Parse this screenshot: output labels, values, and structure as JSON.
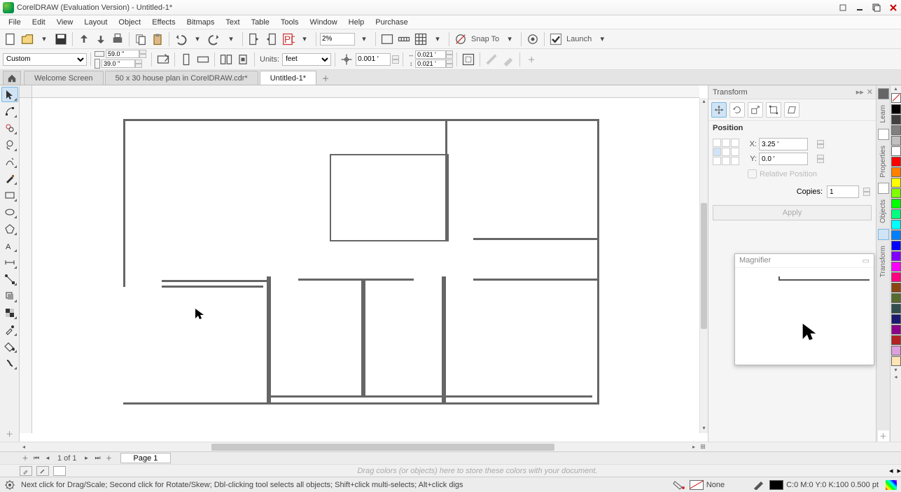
{
  "title": "CorelDRAW (Evaluation Version) - Untitled-1*",
  "menu": [
    "File",
    "Edit",
    "View",
    "Layout",
    "Object",
    "Effects",
    "Bitmaps",
    "Text",
    "Table",
    "Tools",
    "Window",
    "Help",
    "Purchase"
  ],
  "toolbar1": {
    "zoom": "2%",
    "snap_label": "Snap To",
    "launch_label": "Launch"
  },
  "propbar": {
    "page_preset": "Custom",
    "width": "59.0 \"",
    "height": "39.0 \"",
    "units_label": "Units:",
    "units_value": "feet",
    "nudge": "0.001 '",
    "dup_x": "0.021 '",
    "dup_y": "0.021 '"
  },
  "tabs": {
    "home": "home",
    "t1": "Welcome Screen",
    "t2": "50 x 30 house plan in CorelDRAW.cdr*",
    "t3": "Untitled-1*"
  },
  "docker": {
    "title": "Transform",
    "section": "Position",
    "x_label": "X:",
    "x_val": "3.25 '",
    "y_label": "Y:",
    "y_val": "0.0 '",
    "relative": "Relative Position",
    "copies_label": "Copies:",
    "copies_val": "1",
    "apply": "Apply"
  },
  "magnifier": {
    "title": "Magnifier"
  },
  "right_tabs": [
    "Learn",
    "Properties",
    "Objects",
    "Transform"
  ],
  "palette": [
    "#000000",
    "#404040",
    "#808080",
    "#c0c0c0",
    "#ffffff",
    "#ff0000",
    "#ff8000",
    "#ffff00",
    "#80ff00",
    "#00ff00",
    "#00ff80",
    "#00ffff",
    "#0080ff",
    "#0000ff",
    "#8000ff",
    "#ff00ff",
    "#ff0080",
    "#8b4513",
    "#556b2f",
    "#2f4f4f",
    "#191970",
    "#8b008b",
    "#b22222",
    "#dda0dd",
    "#ffe4b5"
  ],
  "page_nav": {
    "of": "1 of 1",
    "page1": "Page 1"
  },
  "color_drop_hint": "Drag colors (or objects) here to store these colors with your document.",
  "status": {
    "hint": "Next click for Drag/Scale; Second click for Rotate/Skew; Dbl-clicking tool selects all objects; Shift+click multi-selects; Alt+click digs",
    "fill_label": "None",
    "cmyk": "C:0 M:0 Y:0 K:100  0.500 pt"
  }
}
